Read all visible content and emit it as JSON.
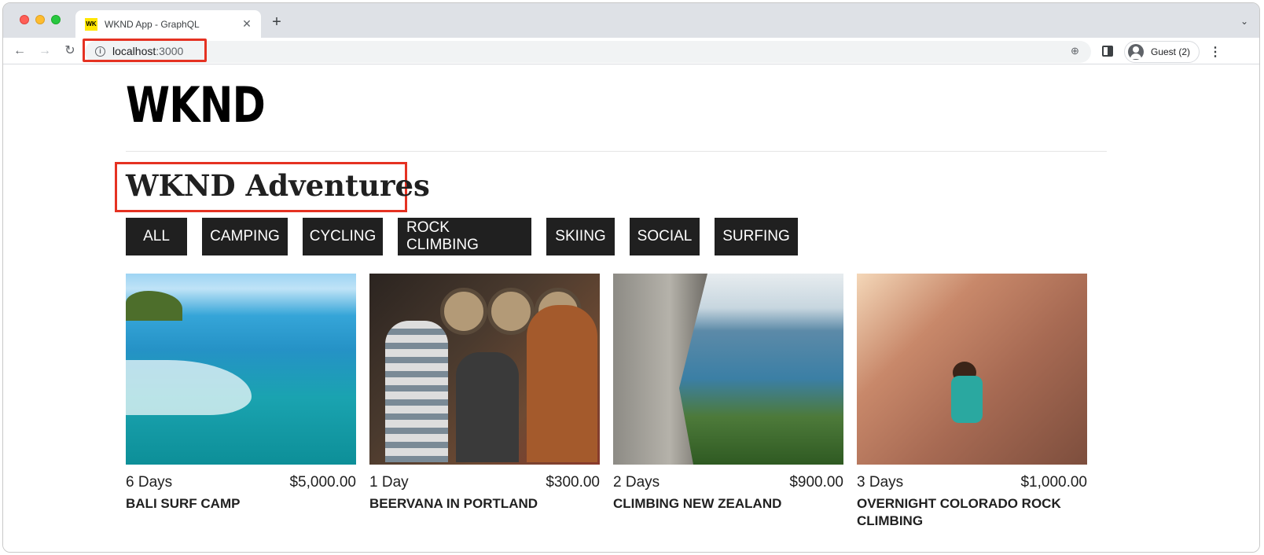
{
  "browser": {
    "tab_title": "WKND App - GraphQL",
    "favicon_text": "WK",
    "url_host": "localhost",
    "url_port": ":3000",
    "profile_label": "Guest (2)"
  },
  "site": {
    "logo": "WKND",
    "heading": "WKND Adventures",
    "filters": [
      "ALL",
      "CAMPING",
      "CYCLING",
      "ROCK CLIMBING",
      "SKIING",
      "SOCIAL",
      "SURFING"
    ]
  },
  "adventures": [
    {
      "duration": "6 Days",
      "price": "$5,000.00",
      "title": "BALI SURF CAMP",
      "image": "surfing-image"
    },
    {
      "duration": "1 Day",
      "price": "$300.00",
      "title": "BEERVANA IN PORTLAND",
      "image": "pub-friends-image"
    },
    {
      "duration": "2 Days",
      "price": "$900.00",
      "title": "CLIMBING NEW ZEALAND",
      "image": "cliff-lake-image"
    },
    {
      "duration": "3 Days",
      "price": "$1,000.00",
      "title": "OVERNIGHT COLORADO ROCK CLIMBING",
      "image": "rock-climber-image"
    }
  ],
  "colors": {
    "highlight": "#e53222",
    "button_bg": "#202020",
    "logo": "#000000"
  }
}
